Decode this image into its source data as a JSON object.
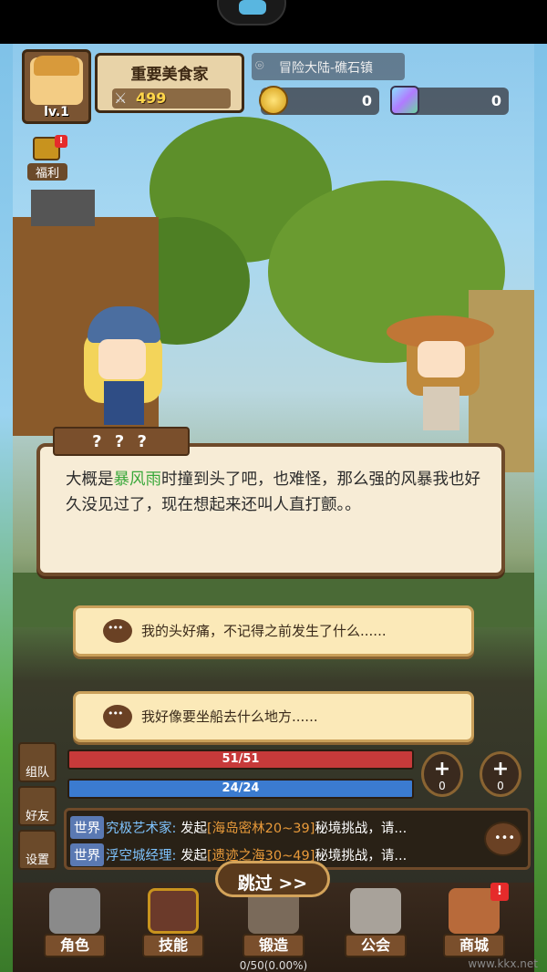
{
  "player": {
    "level": "lv.1",
    "name": "重要美食家",
    "power": "499"
  },
  "location": "冒险大陆-礁石镇",
  "currency": {
    "gold": "0",
    "gems": "0"
  },
  "welfare": {
    "label": "福利",
    "badge": "!"
  },
  "dialogue": {
    "speaker": "? ? ?",
    "text_before": "大概是",
    "highlight": "暴风雨",
    "text_after": "时撞到头了吧，也难怪，那么强的风暴我也好久没见过了，现在想起来还叫人直打颤。。"
  },
  "choices": [
    {
      "text": "我的头好痛，不记得之前发生了什么......"
    },
    {
      "text": "我好像要坐船去什么地方......"
    }
  ],
  "side_menu": {
    "team": "组队",
    "friends": "好友",
    "settings": "设置"
  },
  "hp": {
    "text": "51/51",
    "fraction": 1.0
  },
  "mp": {
    "text": "24/24",
    "fraction": 1.0
  },
  "potions": {
    "hp_count": "0",
    "mp_count": "0",
    "plus": "+"
  },
  "chat": [
    {
      "channel": "世界",
      "name": "究极艺术家:",
      "verb": " 发起",
      "link": "[海岛密林20~39]",
      "rest": "秘境挑战，请..."
    },
    {
      "channel": "世界",
      "name": "浮空城经理:",
      "verb": " 发起",
      "link": "[遗迹之海30~49]",
      "rest": "秘境挑战，请..."
    }
  ],
  "skip": "跳过 >>",
  "nav": {
    "role": "角色",
    "skill": "技能",
    "forge": "锻造",
    "guild": "公会",
    "shop": "商城",
    "shop_badge": "!"
  },
  "exp": "0/50(0.00%)",
  "watermark": "www.kkx.net",
  "colors": {
    "highlight": "#39a83a",
    "hp": "#c73a3a",
    "mp": "#3b7bd0",
    "panel": "#f7ecd6",
    "wood": "#7a4f2c"
  }
}
